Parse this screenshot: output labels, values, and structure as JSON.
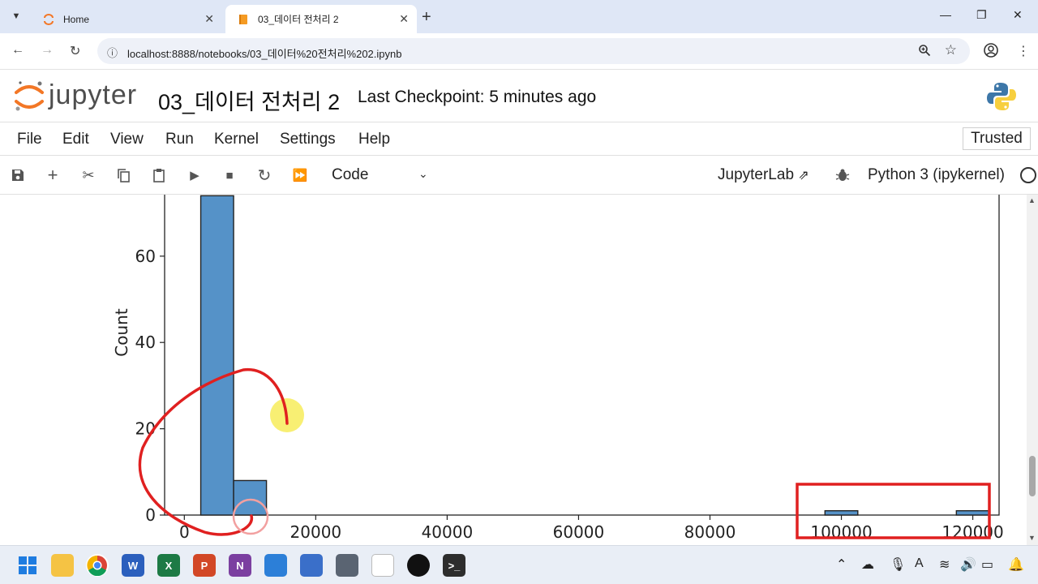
{
  "browser": {
    "tabs": [
      {
        "title": "Home",
        "active": false
      },
      {
        "title": "03_데이터 전처리 2",
        "active": true
      }
    ],
    "url": "localhost:8888/notebooks/03_데이터%20전처리%202.ipynb"
  },
  "jupyter": {
    "logo_text": "jupyter",
    "notebook_title": "03_데이터 전처리 2",
    "checkpoint": "Last Checkpoint: 5 minutes ago",
    "trusted_label": "Trusted",
    "menu": [
      "File",
      "Edit",
      "View",
      "Run",
      "Kernel",
      "Settings",
      "Help"
    ],
    "toolbar": {
      "cell_type": "Code",
      "jupyterlab_label": "JupyterLab",
      "kernel_label": "Python 3 (ipykernel)"
    }
  },
  "chart_data": {
    "type": "bar",
    "ylabel": "Count",
    "xticks": [
      0,
      20000,
      40000,
      60000,
      80000,
      100000,
      120000
    ],
    "yticks": [
      0,
      20,
      40,
      60
    ],
    "xlim": [
      -3000,
      124000
    ],
    "ylim": [
      0,
      74
    ],
    "bar_color": "#5592c8",
    "bins": [
      {
        "x0": 2500,
        "x1": 7500,
        "count": 74
      },
      {
        "x0": 7500,
        "x1": 12500,
        "count": 8
      },
      {
        "x0": 97500,
        "x1": 102500,
        "count": 1
      },
      {
        "x0": 117500,
        "x1": 122500,
        "count": 1
      }
    ]
  },
  "annotations": {
    "pen_color": "#e02020",
    "highlight_color": "#f7ec5a"
  },
  "taskbar": {
    "apps": [
      "start",
      "file-explorer",
      "chrome",
      "word",
      "excel",
      "powerpoint",
      "onenote",
      "app",
      "notepad",
      "calculator",
      "snipping-tool",
      "app",
      "terminal"
    ]
  }
}
